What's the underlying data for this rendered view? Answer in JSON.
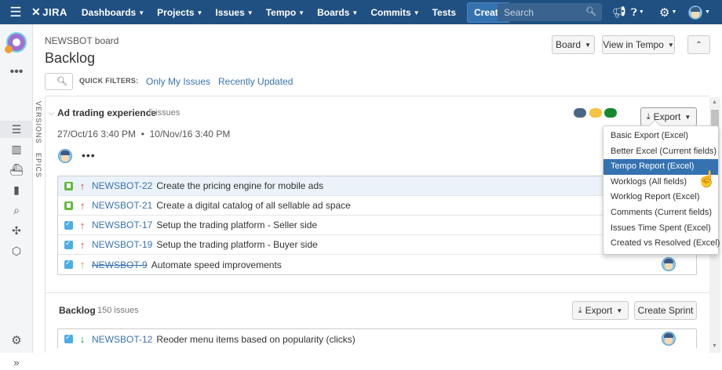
{
  "topnav": {
    "logo": "JIRA",
    "items": [
      {
        "label": "Dashboards",
        "caret": true
      },
      {
        "label": "Projects",
        "caret": true
      },
      {
        "label": "Issues",
        "caret": true
      },
      {
        "label": "Tempo",
        "caret": true
      },
      {
        "label": "Boards",
        "caret": true
      },
      {
        "label": "Commits",
        "caret": true
      },
      {
        "label": "Tests",
        "caret": false
      }
    ],
    "create_label": "Create",
    "search_placeholder": "Search",
    "icons": [
      "notifications-icon",
      "help-icon",
      "settings-icon",
      "user-avatar"
    ]
  },
  "header": {
    "board_name": "NEWSBOT board",
    "title": "Backlog",
    "board_button": "Board",
    "view_tempo_button": "View in Tempo",
    "collapse_button": "^"
  },
  "quick_filters": {
    "label": "QUICK FILTERS:",
    "items": [
      "Only My Issues",
      "Recently Updated"
    ]
  },
  "vertical_tabs": [
    "VERSIONS",
    "EPICS"
  ],
  "sprint": {
    "name": "Ad trading experience",
    "count": "5 issues",
    "dates": "27/Oct/16 3:40 PM  •  10/Nov/16 3:40 PM",
    "status_colors": [
      "#4a6785",
      "#f6c342",
      "#14892c"
    ],
    "export_label": "Export",
    "issues": [
      {
        "type": "story",
        "priority": "high",
        "key": "NEWSBOT-22",
        "summary": "Create the pricing engine for mobile ads",
        "done": false,
        "selected": true
      },
      {
        "type": "story",
        "priority": "high",
        "key": "NEWSBOT-21",
        "summary": "Create a digital catalog of all sellable ad space",
        "done": false,
        "selected": false
      },
      {
        "type": "task",
        "priority": "high",
        "key": "NEWSBOT-17",
        "summary": "Setup the trading platform - Seller side",
        "done": false,
        "selected": false
      },
      {
        "type": "task",
        "priority": "high",
        "key": "NEWSBOT-19",
        "summary": "Setup the trading platform - Buyer side",
        "done": false,
        "selected": false
      },
      {
        "type": "task",
        "priority": "medium",
        "key": "NEWSBOT-9",
        "summary": "Automate speed improvements",
        "done": true,
        "selected": false
      }
    ]
  },
  "export_menu": {
    "items": [
      "Basic Export (Excel)",
      "Better Excel (Current fields)",
      "Tempo Report (Excel)",
      "Worklogs (All fields)",
      "Worklog Report (Excel)",
      "Comments (Current fields)",
      "Issues Time Spent (Excel)",
      "Created vs Resolved (Excel)"
    ],
    "active_index": 2
  },
  "backlog": {
    "title": "Backlog",
    "count": "150 issues",
    "export_label": "Export",
    "create_sprint_label": "Create Sprint",
    "issues": [
      {
        "type": "task",
        "priority": "low",
        "key": "NEWSBOT-12",
        "summary": "Reoder menu items based on popularity (clicks)",
        "done": false,
        "selected": false
      }
    ]
  },
  "colors": {
    "nav_bg": "#205081",
    "link": "#3b73af",
    "menu_active": "#3572b0"
  }
}
